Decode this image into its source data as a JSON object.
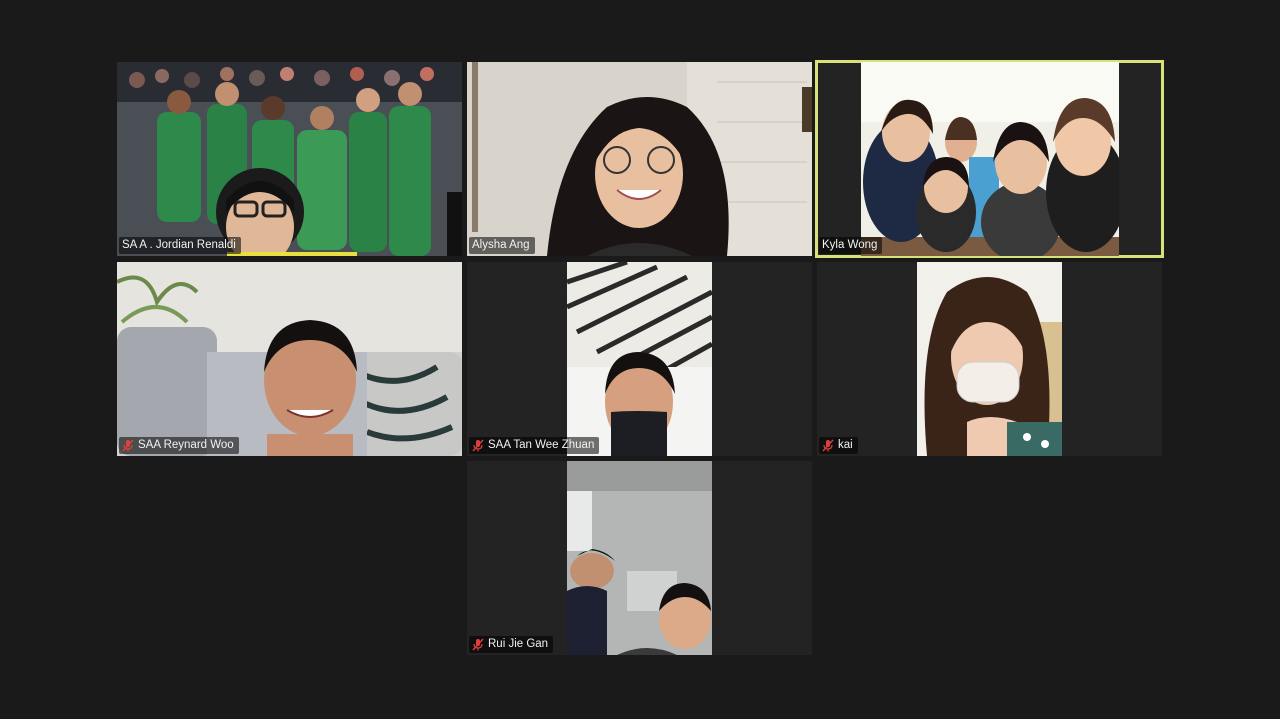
{
  "meeting": {
    "participants": [
      {
        "name": "SA A . Jordian Renaldi",
        "muted": false,
        "active": false
      },
      {
        "name": "Alysha Ang",
        "muted": false,
        "active": false
      },
      {
        "name": "Kyla Wong",
        "muted": false,
        "active": true
      },
      {
        "name": "SAA Reynard Woo",
        "muted": true,
        "active": false
      },
      {
        "name": "SAA Tan Wee Zhuan",
        "muted": true,
        "active": false
      },
      {
        "name": "kai",
        "muted": true,
        "active": false
      },
      {
        "name": "Rui Jie Gan",
        "muted": true,
        "active": false
      }
    ],
    "icons": {
      "muted": "microphone-muted-icon"
    },
    "colors": {
      "background": "#1a1a1a",
      "tile": "#232323",
      "active_speaker_border": "#d8e07a",
      "mute_icon": "#e0403a"
    }
  }
}
